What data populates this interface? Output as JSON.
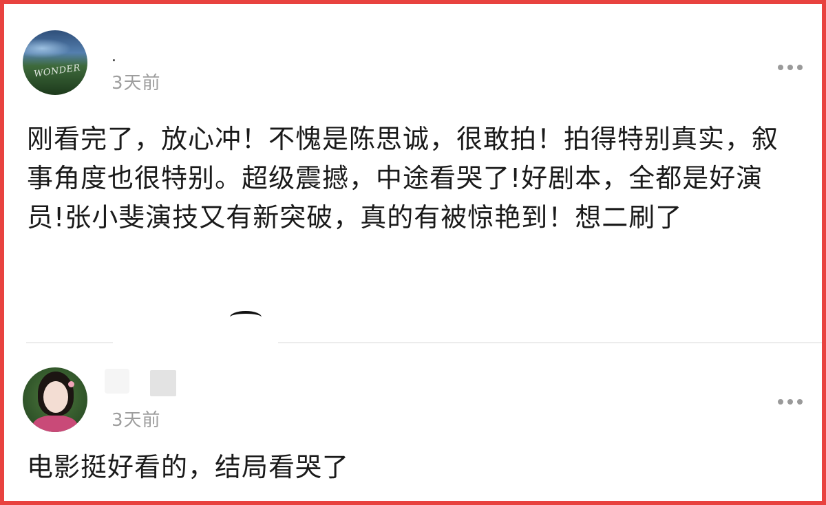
{
  "comments": [
    {
      "username": ".",
      "time": "3天前",
      "text": "刚看完了，放心冲！不愧是陈思诚，很敢拍！拍得特别真实，叙事角度也很特别。超级震撼，中途看哭了!好剧本，全都是好演员!张小斐演技又有新突破，真的有被惊艳到！想二刷了",
      "avatar_text": "WONDER"
    },
    {
      "username": "",
      "time": "3天前",
      "text": "电影挺好看的，结局看哭了"
    }
  ],
  "icons": {
    "more": "more-dots-icon"
  },
  "colors": {
    "frame_border": "#e8423f",
    "timestamp": "#9e9e9e",
    "body_text": "#1a1a1a"
  }
}
